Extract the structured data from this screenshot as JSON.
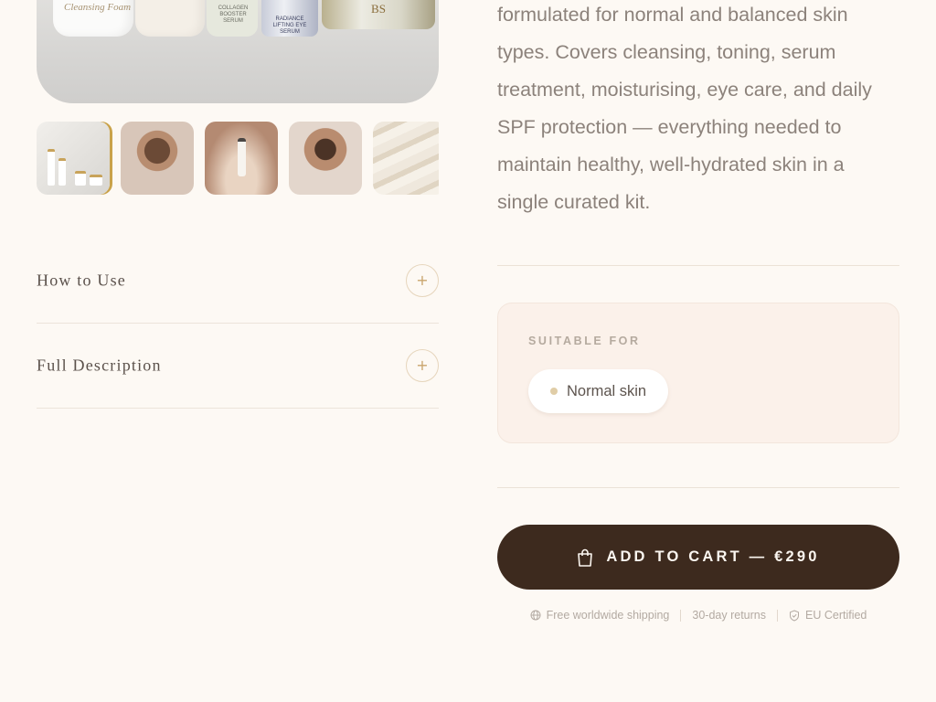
{
  "hero": {
    "labels": {
      "foam": "Cleansing Foam",
      "serum": "COLLAGEN BOOSTER SERUM",
      "eye": "RADIANCE LIFTING EYE SERUM",
      "brand": "BS"
    }
  },
  "accordion": [
    {
      "title": "How to Use",
      "toggle": "+"
    },
    {
      "title": "Full Description",
      "toggle": "+"
    }
  ],
  "description": "formulated for normal and balanced skin types. Covers cleansing, toning, serum treatment, moisturising, eye care, and daily SPF protection — everything needed to maintain healthy, well-hydrated skin in a single curated kit.",
  "suitable": {
    "label": "SUITABLE FOR",
    "chips": [
      "Normal skin"
    ]
  },
  "cart": {
    "label": "ADD TO CART — €290"
  },
  "trust": {
    "shipping": "Free worldwide shipping",
    "returns": "30-day returns",
    "certified": "EU Certified"
  },
  "colors": {
    "background": "#fdf9f4",
    "button": "#3d2a1e",
    "accent": "#c9a24a"
  }
}
